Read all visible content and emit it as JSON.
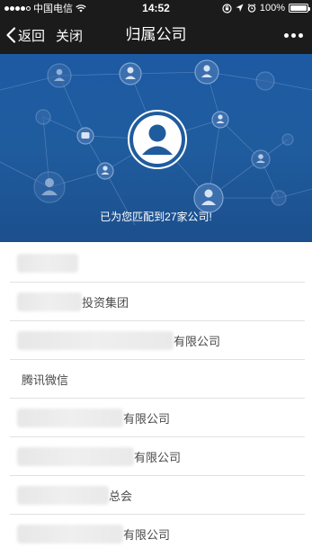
{
  "status_bar": {
    "carrier": "中国电信",
    "time": "14:52",
    "battery": "100%",
    "battery_level": 1.0
  },
  "nav": {
    "back_label": "返回",
    "close_label": "关闭",
    "title": "归属公司"
  },
  "banner": {
    "message": "已为您匹配到27家公司!"
  },
  "companies": [
    {
      "suffix": ""
    },
    {
      "suffix": "投资集团"
    },
    {
      "suffix": "有限公司"
    },
    {
      "suffix": "腾讯微信"
    },
    {
      "suffix": "有限公司"
    },
    {
      "suffix": "有限公司"
    },
    {
      "suffix": "总会"
    },
    {
      "suffix": "有限公司"
    }
  ],
  "colors": {
    "bar_bg": "#1b1b1b",
    "banner_bg": "#1f5c9e",
    "divider": "#e1e1e1",
    "text": "#4a4a4a"
  }
}
